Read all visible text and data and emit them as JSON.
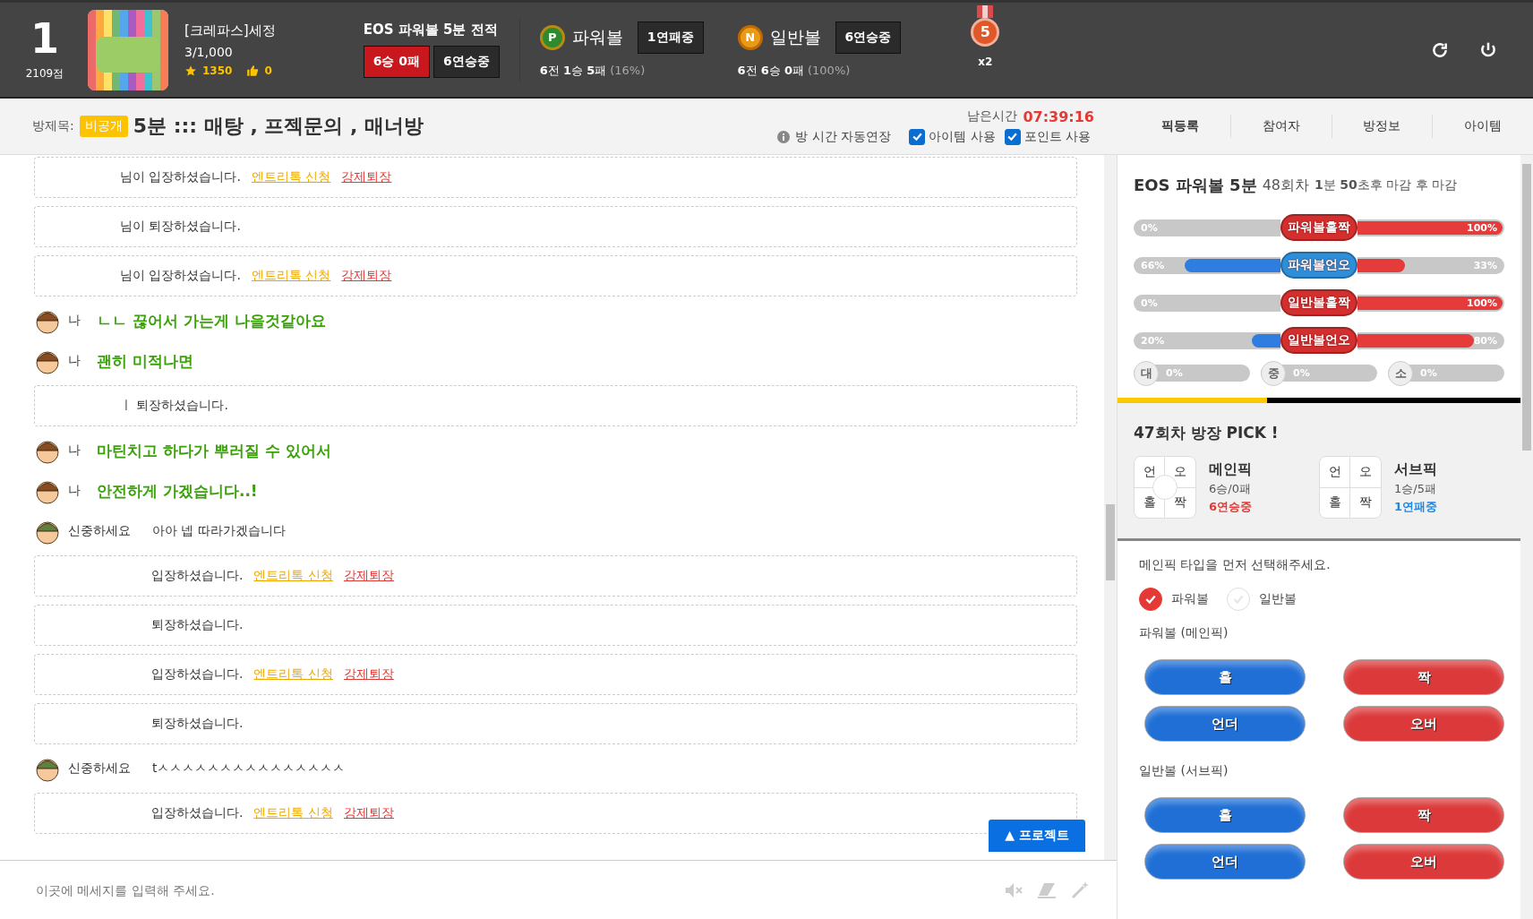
{
  "header": {
    "rank": "1",
    "score": "2109점",
    "nickname": "[크레파스]세정",
    "members": "3/1,000",
    "stars": "1350",
    "likes": "0",
    "record_title": "EOS 파워볼 5분 전적",
    "record": "6승 0패",
    "record_streak": "6연승중",
    "balls": [
      {
        "kind": "power",
        "letter": "P",
        "name": "파워볼",
        "streak": "1연패중",
        "stats": "**6**전 **1**승 **5**패",
        "pct": "(16%)"
      },
      {
        "kind": "normal",
        "letter": "N",
        "name": "일반볼",
        "streak": "6연승중",
        "stats": "**6**전 **6**승 **0**패",
        "pct": "(100%)"
      }
    ],
    "medal": "5",
    "multiplier": "x2"
  },
  "room": {
    "label": "방제목:",
    "badge": "비공개",
    "title": "5분 ::: 매탕 , 프젝문의 , 매너방",
    "time_label": "남은시간",
    "time": "07:39:16",
    "auto_extend": "방 시간 자동연장",
    "options": [
      {
        "label": "아이템 사용",
        "checked": true
      },
      {
        "label": "포인트 사용",
        "checked": true
      }
    ],
    "tabs": [
      {
        "label": "픽등록",
        "selected": true
      },
      {
        "label": "참여자",
        "selected": false
      },
      {
        "label": "방정보",
        "selected": false
      },
      {
        "label": "아이템",
        "selected": false
      }
    ]
  },
  "chat": [
    {
      "kind": "system",
      "text": "님이 입장하셨습니다.",
      "links": [
        "엔트리톡 신청",
        "강제퇴장"
      ]
    },
    {
      "kind": "system",
      "text": "님이 퇴장하셨습니다."
    },
    {
      "kind": "system",
      "text": "님이 입장하셨습니다.",
      "links": [
        "엔트리톡 신청",
        "강제퇴장"
      ]
    },
    {
      "kind": "me",
      "name": "나",
      "text": "ㄴㄴ 끊어서 가는게 나을것같아요"
    },
    {
      "kind": "me",
      "name": "나",
      "text": "괜히 미적나면"
    },
    {
      "kind": "system",
      "text": "ㅣ 퇴장하셨습니다."
    },
    {
      "kind": "me",
      "name": "나",
      "text": "마틴치고 하다가 뿌러질 수 있어서"
    },
    {
      "kind": "me",
      "name": "나",
      "text": "안전하게 가겠습니다..!"
    },
    {
      "kind": "other",
      "name": "신중하세요",
      "text": "아아 넵 따라가겠습니다"
    },
    {
      "kind": "system",
      "text": "입장하셨습니다.",
      "links": [
        "엔트리톡 신청",
        "강제퇴장"
      ]
    },
    {
      "kind": "system",
      "text": "퇴장하셨습니다."
    },
    {
      "kind": "system",
      "text": "입장하셨습니다.",
      "links": [
        "엔트리톡 신청",
        "강제퇴장"
      ]
    },
    {
      "kind": "system",
      "text": "퇴장하셨습니다."
    },
    {
      "kind": "other",
      "name": "신중하세요",
      "text": "tㅅㅅㅅㅅㅅㅅㅅㅅㅅㅅㅅㅅㅅㅅㅅ"
    },
    {
      "kind": "system",
      "text": "입장하셨습니다.",
      "links": [
        "엔트리톡 신청",
        "강제퇴장"
      ]
    }
  ],
  "project_button": "▲ 프로젝트",
  "input": {
    "placeholder": "이곳에 메세지를 입력해 주세요."
  },
  "game": {
    "title": "EOS 파워볼 5분",
    "round": "48회차",
    "deadline": "**1**분 **50**초후 마감 후 마감",
    "bars": [
      {
        "label": "파워볼홀짝",
        "color": "#d32f2f",
        "left": {
          "text": "0%"
        },
        "right": {
          "text": "100%",
          "level": 1
        }
      },
      {
        "label": "파워볼언오",
        "color": "#2e8fd8",
        "left": {
          "text": "66%",
          "level": 0.66
        },
        "right": {
          "text": "33%",
          "level": 0.33
        }
      },
      {
        "label": "일반볼홀짝",
        "color": "#d32f2f",
        "left": {
          "text": "0%"
        },
        "right": {
          "text": "100%",
          "level": 1
        }
      },
      {
        "label": "일반볼언오",
        "color": "#d32f2f",
        "left": {
          "text": "20%",
          "level": 0.2
        },
        "right": {
          "text": "80%",
          "level": 0.8
        }
      }
    ],
    "sizes": [
      {
        "label": "대",
        "value": "0%",
        "level": 0
      },
      {
        "label": "중",
        "value": "0%",
        "level": 0
      },
      {
        "label": "소",
        "value": "0%",
        "level": 0
      }
    ],
    "timer": {
      "level": 0.37
    }
  },
  "pick": {
    "title": "47회차 방장 PICK !",
    "items": [
      {
        "cells": [
          "언",
          "오",
          "홀",
          "짝"
        ],
        "marked": true,
        "name": "메인픽",
        "record": "6승/0패",
        "streak": "6연승중",
        "color": "#e53935"
      },
      {
        "cells": [
          "언",
          "오",
          "홀",
          "짝"
        ],
        "marked": false,
        "name": "서브픽",
        "record": "1승/5패",
        "streak": "1연패중",
        "color": "#1e88e5"
      }
    ]
  },
  "form": {
    "prompt": "메인픽 타입을 먼저 선택해주세요.",
    "types": [
      {
        "label": "파워볼",
        "selected": true
      },
      {
        "label": "일반볼",
        "selected": false
      }
    ],
    "groups": [
      {
        "title": "파워볼 (메인픽)",
        "buttons": [
          {
            "label": "홀",
            "color": "#1f6fd6"
          },
          {
            "label": "짝",
            "color": "#dc3a3a"
          },
          {
            "label": "언더",
            "color": "#1f6fd6"
          },
          {
            "label": "오버",
            "color": "#dc3a3a"
          }
        ]
      },
      {
        "title": "일반볼 (서브픽)",
        "buttons": [
          {
            "label": "홀",
            "color": "#1f6fd6"
          },
          {
            "label": "짝",
            "color": "#dc3a3a"
          },
          {
            "label": "언더",
            "color": "#1f6fd6"
          },
          {
            "label": "오버",
            "color": "#dc3a3a"
          }
        ]
      }
    ]
  }
}
